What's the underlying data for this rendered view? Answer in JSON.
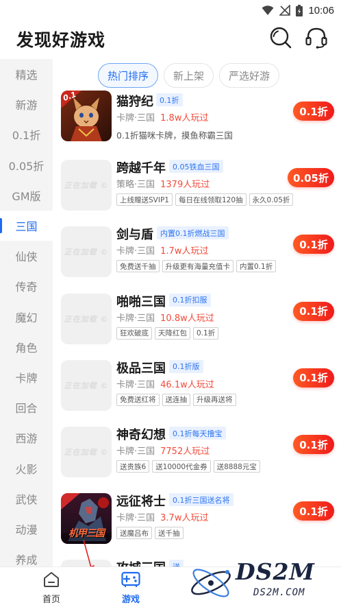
{
  "status_bar": {
    "time": "10:06"
  },
  "header": {
    "title": "发现好游戏"
  },
  "sidebar": {
    "items": [
      {
        "label": "精选",
        "active": false
      },
      {
        "label": "新游",
        "active": false
      },
      {
        "label": "0.1折",
        "active": false
      },
      {
        "label": "0.05折",
        "active": false
      },
      {
        "label": "GM版",
        "active": false
      },
      {
        "label": "三国",
        "active": true
      },
      {
        "label": "仙侠",
        "active": false
      },
      {
        "label": "传奇",
        "active": false
      },
      {
        "label": "魔幻",
        "active": false
      },
      {
        "label": "角色",
        "active": false
      },
      {
        "label": "卡牌",
        "active": false
      },
      {
        "label": "回合",
        "active": false
      },
      {
        "label": "西游",
        "active": false
      },
      {
        "label": "火影",
        "active": false
      },
      {
        "label": "武侠",
        "active": false
      },
      {
        "label": "动漫",
        "active": false
      },
      {
        "label": "养成",
        "active": false
      }
    ]
  },
  "filters": {
    "tabs": [
      {
        "label": "热门排序",
        "active": true
      },
      {
        "label": "新上架",
        "active": false
      },
      {
        "label": "严选好游",
        "active": false
      }
    ]
  },
  "games": [
    {
      "name": "猫狩纪",
      "badge": "0.1折",
      "genre": "卡牌·三国",
      "players": "1.8w人玩过",
      "desc": "0.1折猫咪卡牌，摸鱼称霸三国",
      "tags": [],
      "discount": "0.1折",
      "icon": "art",
      "icon_text": "0.1"
    },
    {
      "name": "跨越千年",
      "badge": "0.05铁血三国",
      "genre": "策略·三国",
      "players": "1379人玩过",
      "desc": "",
      "tags": [
        "上线赠送SVIP1",
        "每日在线领取120抽",
        "永久0.05折"
      ],
      "discount": "0.05折",
      "icon": "placeholder"
    },
    {
      "name": "剑与盾",
      "badge": "内置0.1折燃战三国",
      "genre": "卡牌·三国",
      "players": "1.7w人玩过",
      "desc": "",
      "tags": [
        "免费送千抽",
        "升级更有海量充值卡",
        "内置0.1折"
      ],
      "discount": "0.1折",
      "icon": "placeholder"
    },
    {
      "name": "啪啪三国",
      "badge": "0.1折扣服",
      "genre": "卡牌·三国",
      "players": "10.8w人玩过",
      "desc": "",
      "tags": [
        "狂欢破底",
        "天降红包",
        "0.1折"
      ],
      "discount": "0.1折",
      "icon": "placeholder"
    },
    {
      "name": "极品三国",
      "badge": "0.1折版",
      "genre": "卡牌·三国",
      "players": "46.1w人玩过",
      "desc": "",
      "tags": [
        "免费送红将",
        "送连抽",
        "升级再送将"
      ],
      "discount": "0.1折",
      "icon": "placeholder"
    },
    {
      "name": "神奇幻想",
      "badge": "0.1折每天撸宝",
      "genre": "卡牌·三国",
      "players": "7752人玩过",
      "desc": "",
      "tags": [
        "送贵族6",
        "送10000代金券",
        "送8888元宝"
      ],
      "discount": "0.1折",
      "icon": "placeholder"
    },
    {
      "name": "远征将士",
      "badge": "0.1折三国送名将",
      "genre": "卡牌·三国",
      "players": "3.7w人玩过",
      "desc": "",
      "tags": [
        "送魔吕布",
        "送千抽"
      ],
      "discount": "0.1折",
      "icon": "art",
      "icon_text": "机甲三国"
    },
    {
      "name": "攻城三国",
      "badge": "送",
      "genre": "",
      "players": "",
      "desc": "",
      "tags": [],
      "discount": "",
      "icon": "placeholder"
    }
  ],
  "placeholder_text": "正在加载 ©",
  "bottom_nav": {
    "items": [
      {
        "label": "首页",
        "active": false
      },
      {
        "label": "游戏",
        "active": true
      }
    ]
  },
  "watermark": {
    "title": "DS2M",
    "subtitle": "DS2M.COM"
  },
  "colors": {
    "accent": "#1e6bf0",
    "discount_start": "#ff5a24",
    "discount_end": "#ee1b1b",
    "players": "#f24a3a",
    "sidebar_bg": "#f4f4f4"
  }
}
